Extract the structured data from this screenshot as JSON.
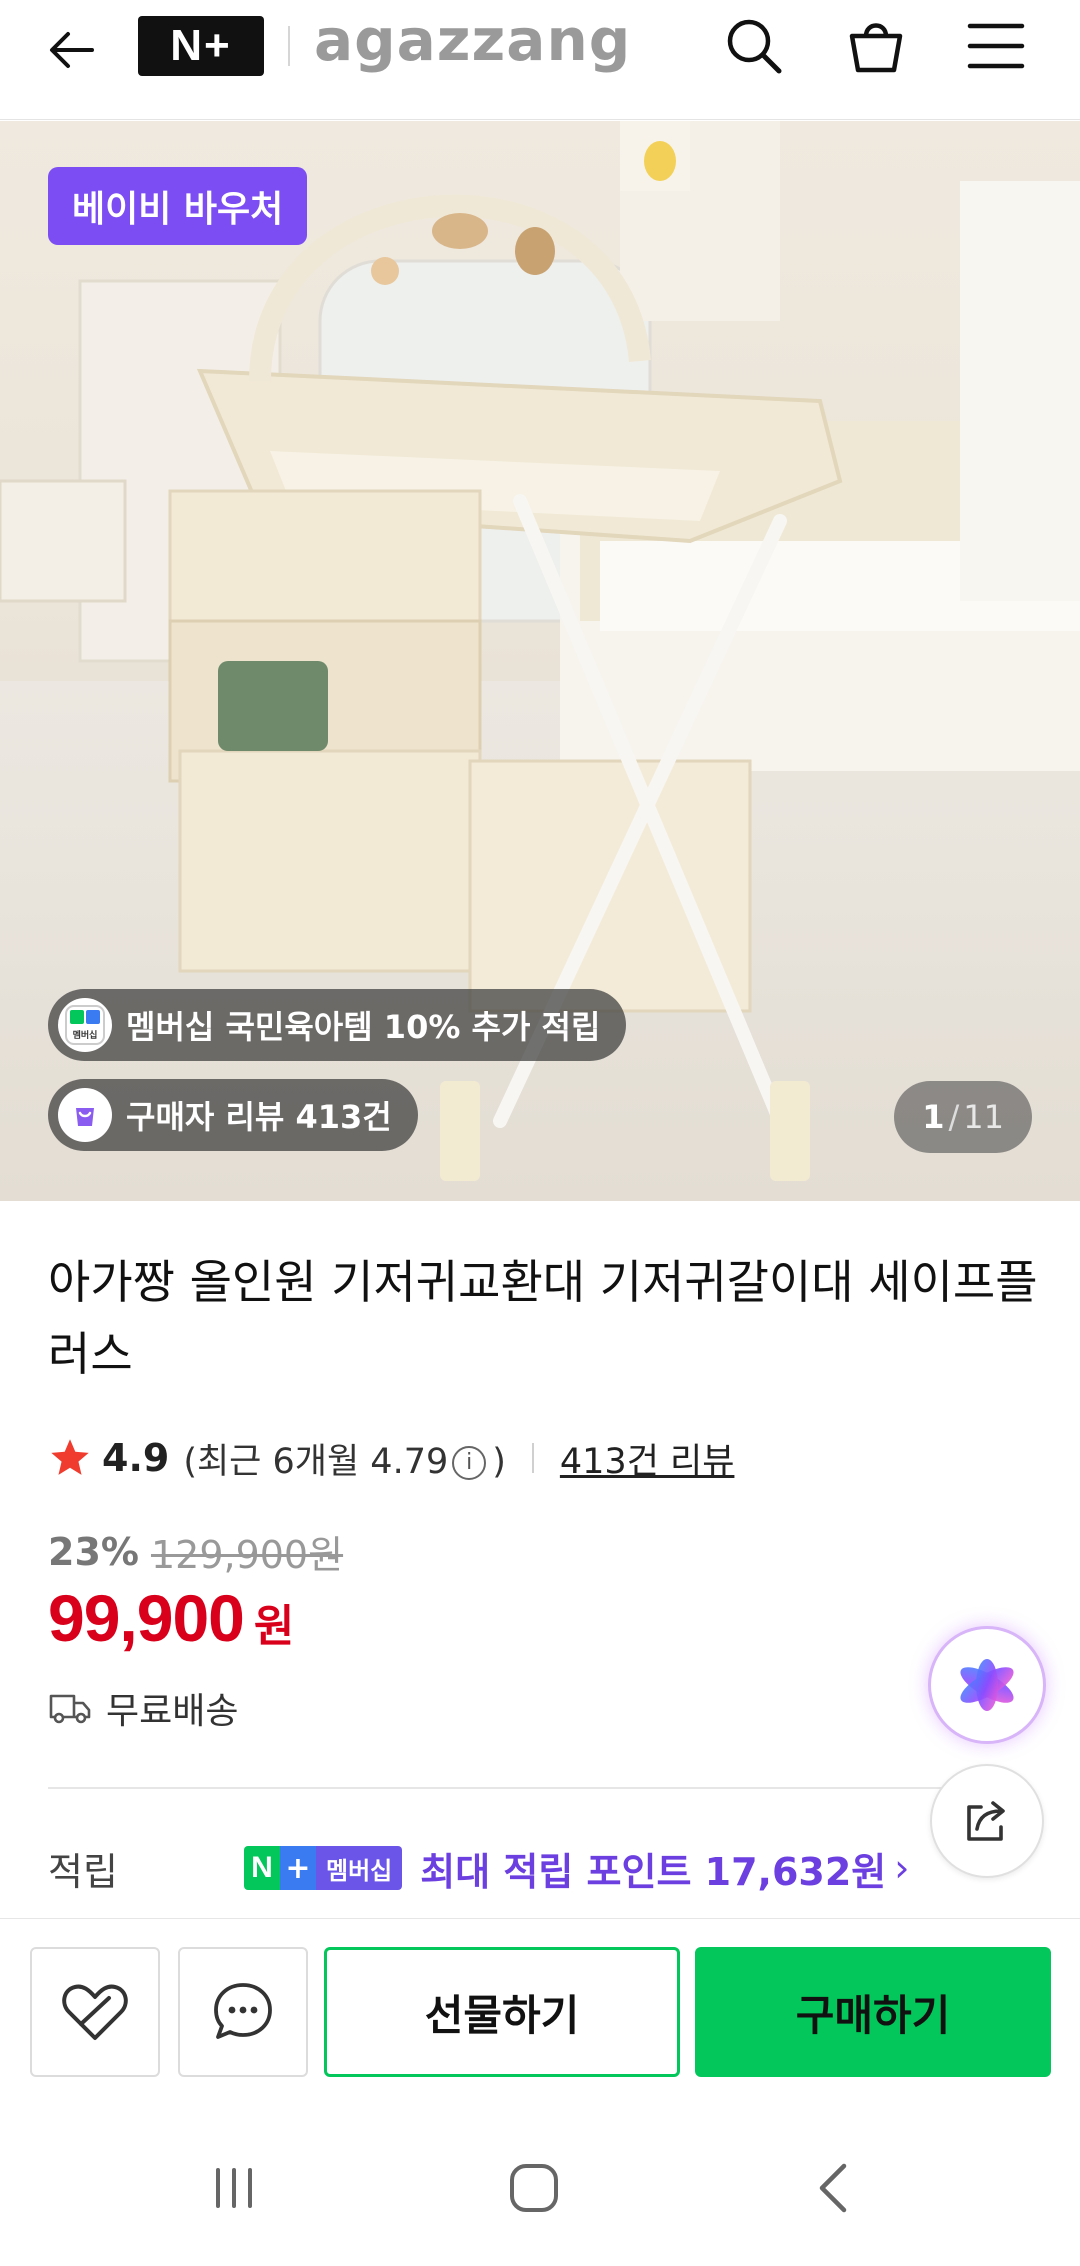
{
  "header": {
    "np_logo": "N+",
    "brand_logo": "agazzang",
    "icons": [
      "back-arrow-icon",
      "search-icon",
      "cart-icon",
      "menu-icon"
    ]
  },
  "hero": {
    "voucher_label": "베이비 바우처",
    "membership_pill": "멤버십 국민육아템 10% 추가 적립",
    "membership_pill_icon_label": "멤버십",
    "review_pill": "구매자 리뷰 413건",
    "counter": {
      "current": "1",
      "separator": "/",
      "total": "11"
    }
  },
  "product": {
    "title": "아가짱 올인원 기저귀교환대 기저귀갈이대 세이프플러스",
    "rating": {
      "score": "4.9",
      "recent_prefix": "(최근 6개월 4.79",
      "recent_suffix": ")",
      "review_link": "413건 리뷰"
    },
    "discount_percent": "23%",
    "original_price": "129,900원",
    "price": "99,900",
    "price_unit": "원",
    "shipping": "무료배송"
  },
  "points": {
    "label": "적립",
    "badge_text": "멤버십",
    "text": "최대 적립 포인트 17,632원",
    "chevron": "›"
  },
  "bottom_bar": {
    "gift_label": "선물하기",
    "buy_label": "구매하기"
  },
  "colors": {
    "accent_green": "#03c75a",
    "price_red": "#d9001b",
    "voucher_purple": "#7b4df2",
    "points_purple": "#6b3fe0"
  }
}
